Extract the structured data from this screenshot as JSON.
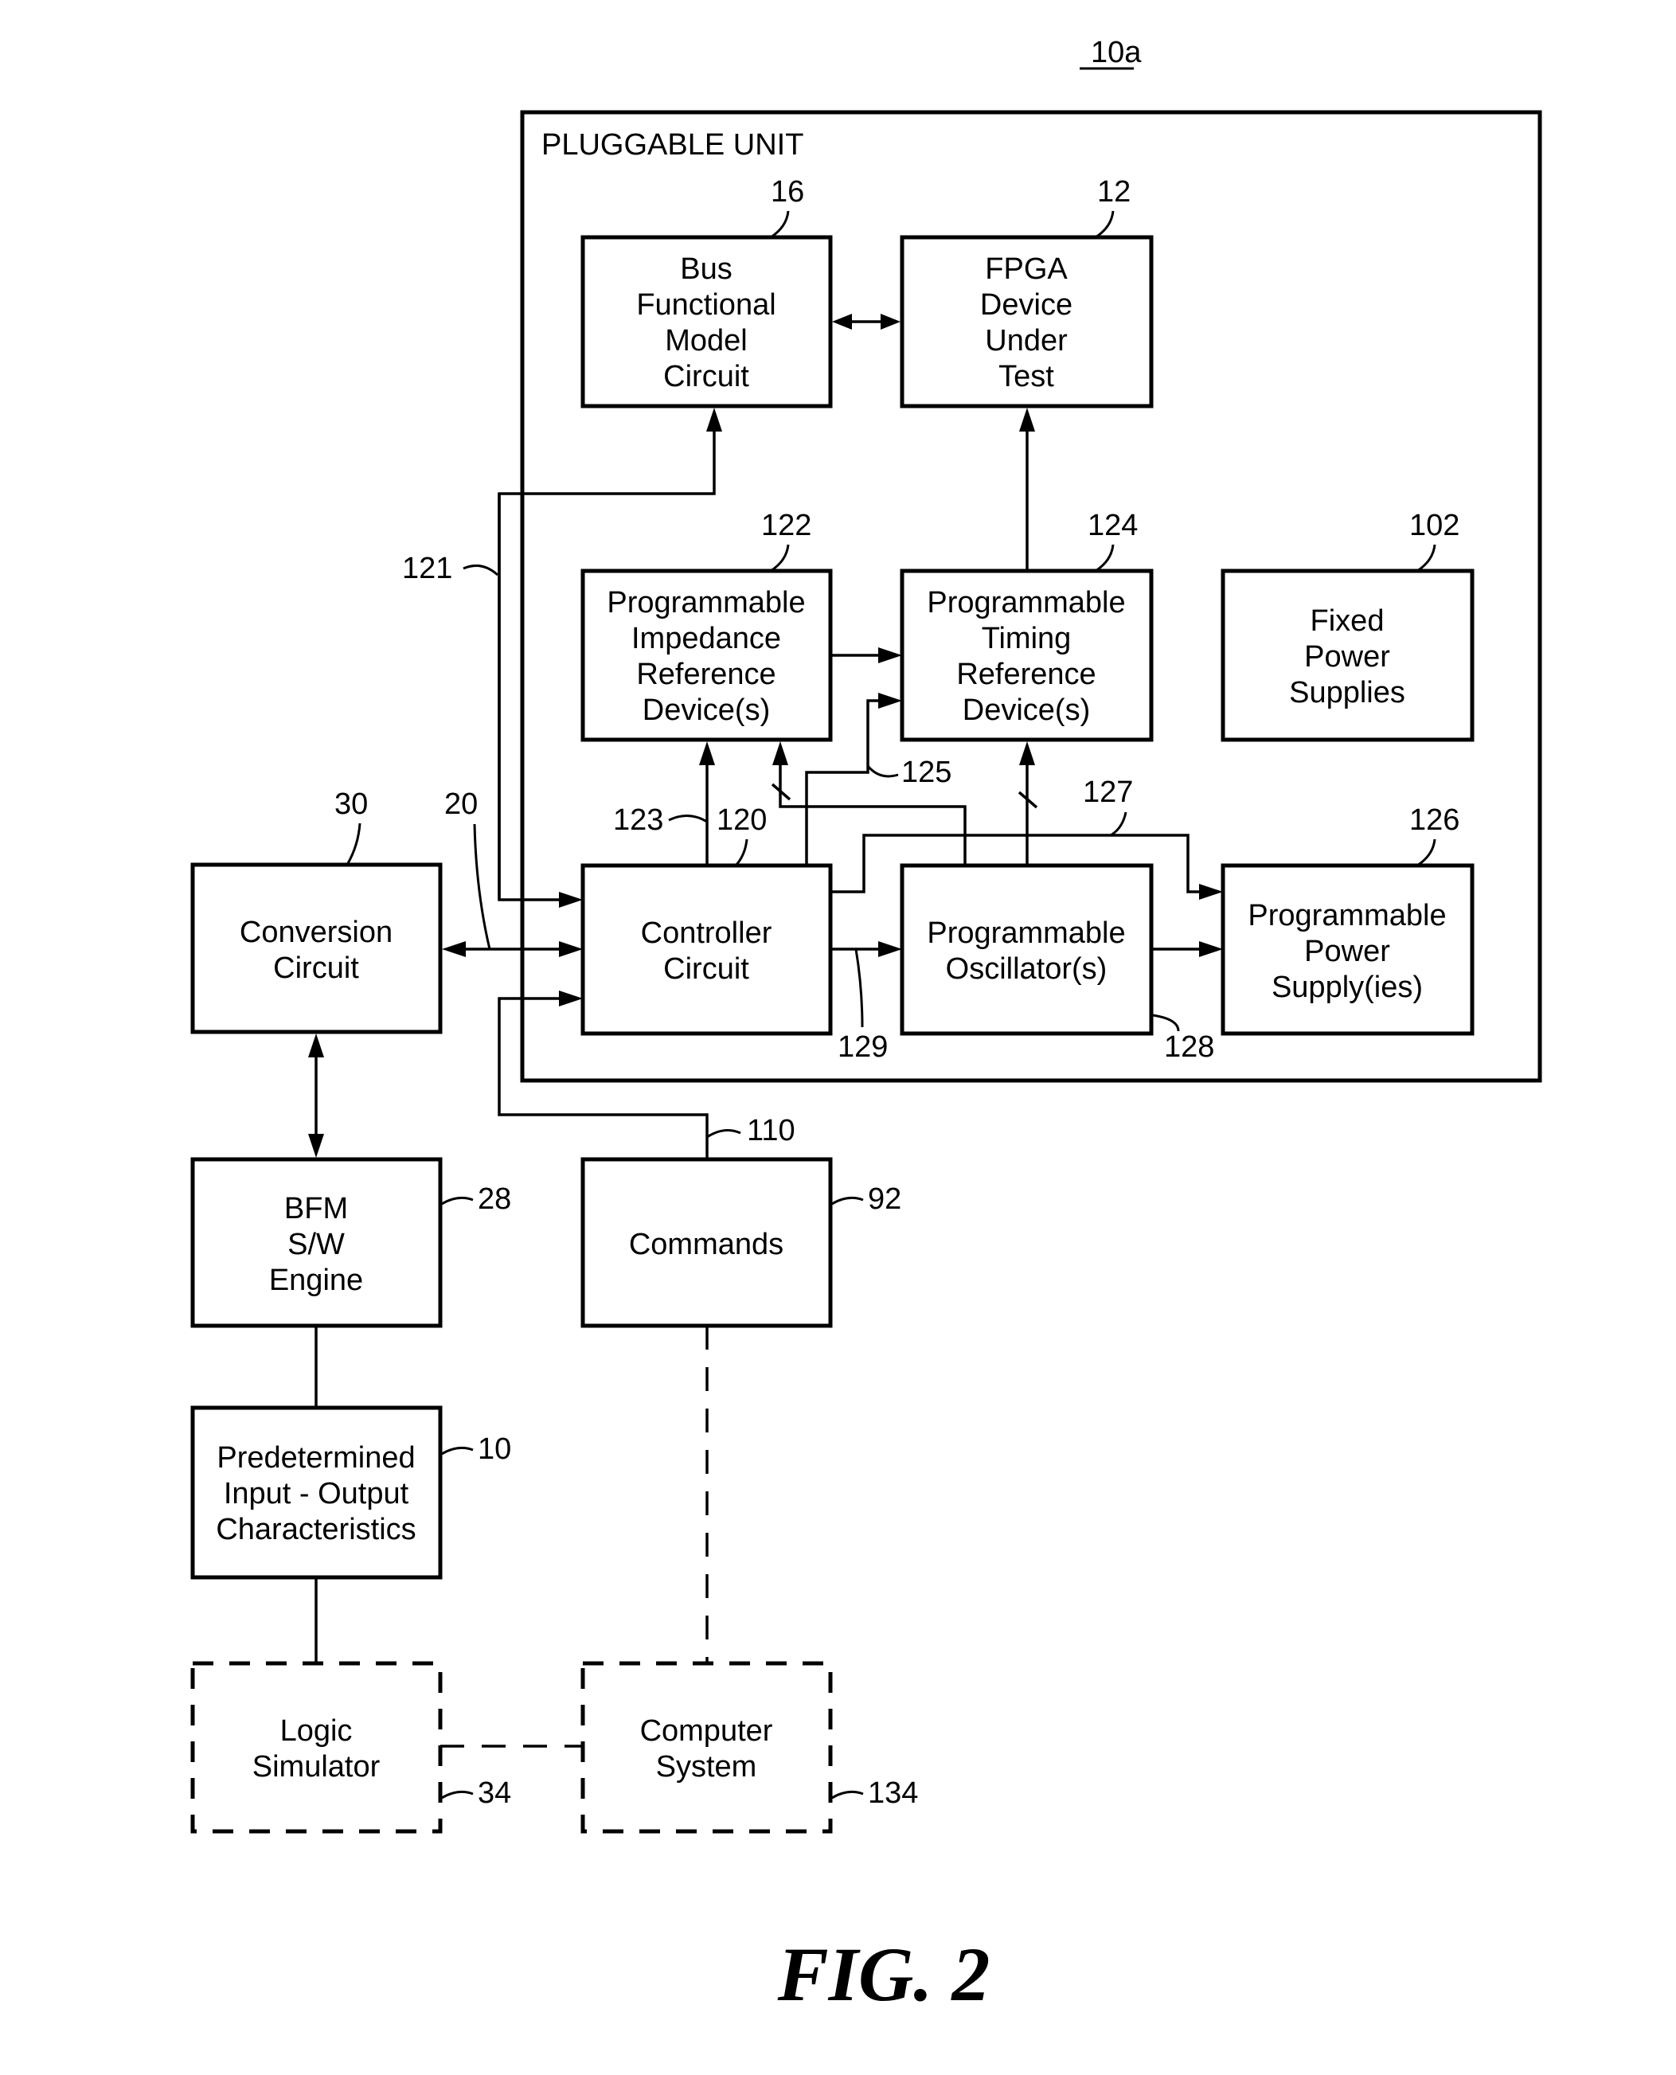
{
  "figure": {
    "label": "FIG. 2",
    "ref": "10a"
  },
  "pluggable_unit": {
    "title": "PLUGGABLE UNIT"
  },
  "blocks": {
    "bfm_circuit": {
      "ref": "16",
      "lines": [
        "Bus",
        "Functional",
        "Model",
        "Circuit"
      ]
    },
    "fpga": {
      "ref": "12",
      "lines": [
        "FPGA",
        "Device",
        "Under",
        "Test"
      ]
    },
    "impedance": {
      "ref": "122",
      "lines": [
        "Programmable",
        "Impedance",
        "Reference",
        "Device(s)"
      ]
    },
    "timing": {
      "ref": "124",
      "lines": [
        "Programmable",
        "Timing",
        "Reference",
        "Device(s)"
      ]
    },
    "fixed_power": {
      "ref": "102",
      "lines": [
        "Fixed",
        "Power",
        "Supplies"
      ]
    },
    "controller": {
      "ref": "120",
      "lines": [
        "Controller",
        "Circuit"
      ]
    },
    "oscillator": {
      "ref": "128",
      "lines": [
        "Programmable",
        "Oscillator(s)"
      ]
    },
    "prog_power": {
      "ref": "126",
      "lines": [
        "Programmable",
        "Power",
        "Supply(ies)"
      ]
    },
    "conversion": {
      "ref": "30",
      "lines": [
        "Conversion",
        "Circuit"
      ]
    },
    "bfm_engine": {
      "ref": "28",
      "lines": [
        "BFM",
        "S/W",
        "Engine"
      ]
    },
    "commands": {
      "ref": "92",
      "lines": [
        "Commands"
      ]
    },
    "predetermined": {
      "ref": "10",
      "lines": [
        "Predetermined",
        "Input - Output",
        "Characteristics"
      ]
    },
    "logic_sim": {
      "ref": "34",
      "lines": [
        "Logic",
        "Simulator"
      ]
    },
    "computer": {
      "ref": "134",
      "lines": [
        "Computer",
        "System"
      ]
    }
  },
  "connections": {
    "bus_121": "121",
    "bus_20": "20",
    "bus_123": "123",
    "bus_125": "125",
    "bus_127": "127",
    "bus_129": "129",
    "bus_110": "110"
  }
}
